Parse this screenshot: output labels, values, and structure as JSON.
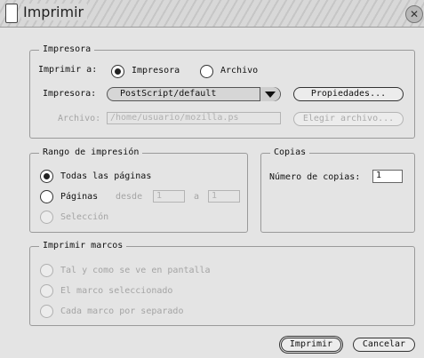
{
  "window": {
    "title": "Imprimir"
  },
  "printer_group": {
    "legend": "Impresora",
    "print_to_label": "Imprimir a:",
    "print_to_options": [
      "Impresora",
      "Archivo"
    ],
    "printer_label": "Impresora:",
    "printer_value": "PostScript/default",
    "properties_button": "Propiedades...",
    "file_label": "Archivo:",
    "file_value": "/home/usuario/mozilla.ps",
    "choose_file_button": "Elegir archivo..."
  },
  "range_group": {
    "legend": "Rango de impresión",
    "all_pages": "Todas las páginas",
    "pages": "Páginas",
    "from_label": "desde",
    "from_value": "1",
    "to_label": "a",
    "to_value": "1",
    "selection": "Selección"
  },
  "copies_group": {
    "legend": "Copias",
    "count_label": "Número de copias:",
    "count_value": "1"
  },
  "frames_group": {
    "legend": "Imprimir marcos",
    "options": [
      "Tal y como se ve en pantalla",
      "El marco seleccionado",
      "Cada marco por separado"
    ]
  },
  "actions": {
    "print": "Imprimir",
    "cancel": "Cancelar"
  }
}
